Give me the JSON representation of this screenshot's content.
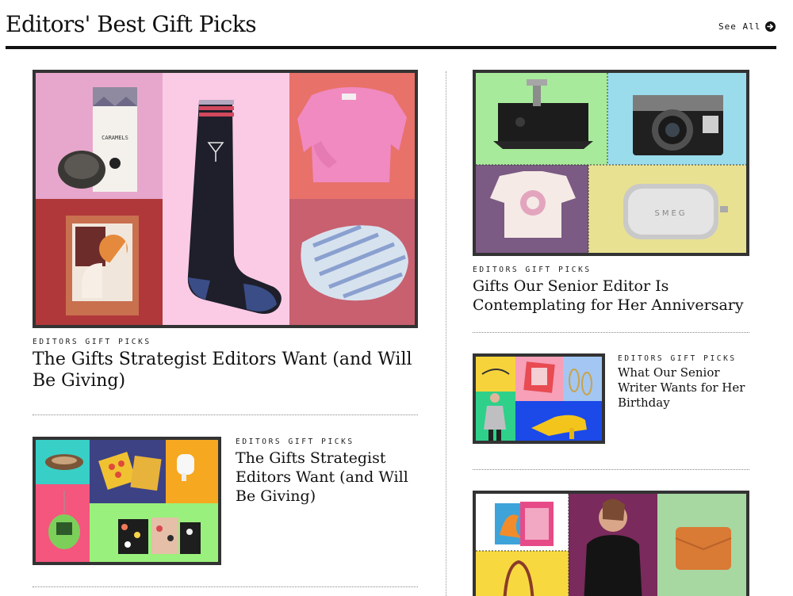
{
  "section": {
    "title": "Editors' Best Gift Picks",
    "see_all_label": "See All",
    "see_all_icon": "arrow-right-circle-icon"
  },
  "articles": [
    {
      "kicker": "EDITORS GIFT PICKS",
      "title": "The Gifts Strategist Editors Want (and Will Be Giving)"
    },
    {
      "kicker": "EDITORS GIFT PICKS",
      "title": "The Gifts Strategist Editors Want (and Will Be Giving)"
    },
    {
      "kicker": "EDITORS GIFT PICKS",
      "title": "Gifts Our Senior Editor Is Contemplating for Her Anniversary"
    },
    {
      "kicker": "EDITORS GIFT PICKS",
      "title": "What Our Senior Writer Wants for Her Birthday"
    }
  ],
  "image_text": {
    "caramels_label": "CARAMELS",
    "toaster_brand": "SMEG"
  },
  "colors": {
    "frame": "#333333",
    "rule": "#111111",
    "pink": "#e7a7cc",
    "light_pink": "#fbcbe6",
    "coral": "#e8716a",
    "brick": "#b0383a",
    "rose": "#c8606f",
    "mint": "#a8ea9b",
    "sky": "#9adcec",
    "mauve": "#7b5a83",
    "butter": "#e9e192"
  }
}
